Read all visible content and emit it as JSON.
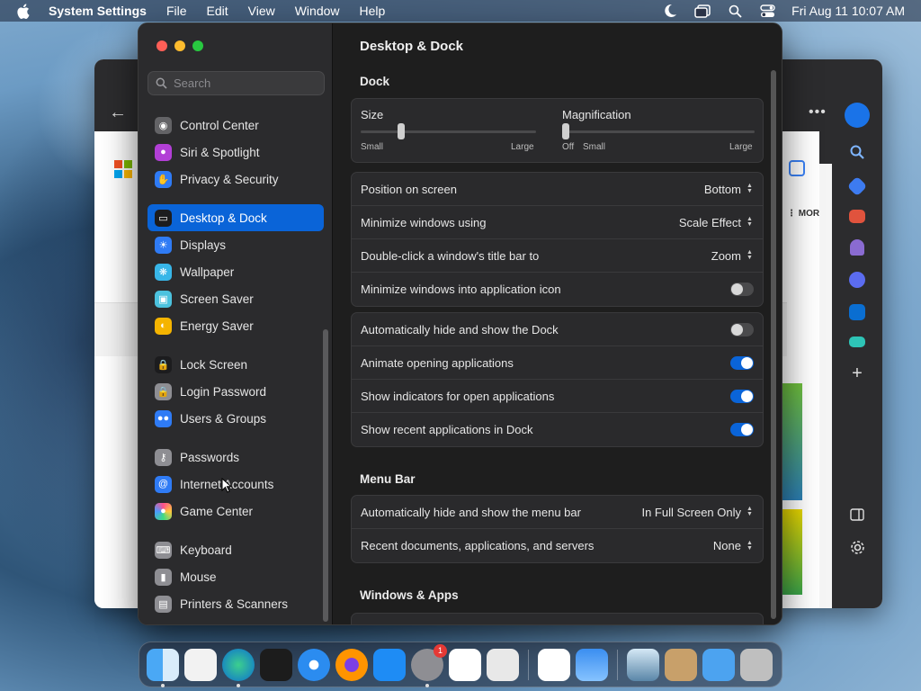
{
  "menubar": {
    "app_name": "System Settings",
    "menus": [
      "File",
      "Edit",
      "View",
      "Window",
      "Help"
    ],
    "clock": "Fri Aug 11  10:07 AM"
  },
  "browser": {
    "more_label": "⋮ MOR"
  },
  "settings": {
    "search_placeholder": "Search",
    "sidebar": [
      {
        "label": "Control Center",
        "icon": "control-center-icon",
        "color": "#636366"
      },
      {
        "label": "Siri & Spotlight",
        "icon": "siri-icon",
        "color": "#b23fd6"
      },
      {
        "label": "Privacy & Security",
        "icon": "hand-icon",
        "color": "#2f7bf5"
      },
      {
        "label": "Desktop & Dock",
        "icon": "dock-icon",
        "color": "#1c1c1e",
        "active": true
      },
      {
        "label": "Displays",
        "icon": "sun-icon",
        "color": "#2f7bf5"
      },
      {
        "label": "Wallpaper",
        "icon": "flower-icon",
        "color": "#38b6e8"
      },
      {
        "label": "Screen Saver",
        "icon": "screen-saver-icon",
        "color": "#4cc2de"
      },
      {
        "label": "Energy Saver",
        "icon": "bulb-icon",
        "color": "#f5b400"
      },
      {
        "label": "Lock Screen",
        "icon": "lock-icon",
        "color": "#1c1c1e"
      },
      {
        "label": "Login Password",
        "icon": "lock-icon",
        "color": "#8e8e93"
      },
      {
        "label": "Users & Groups",
        "icon": "users-icon",
        "color": "#2f7bf5"
      },
      {
        "label": "Passwords",
        "icon": "key-icon",
        "color": "#8e8e93"
      },
      {
        "label": "Internet Accounts",
        "icon": "at-icon",
        "color": "#2f7bf5"
      },
      {
        "label": "Game Center",
        "icon": "game-center-icon",
        "color": "#e8e8e8"
      },
      {
        "label": "Keyboard",
        "icon": "keyboard-icon",
        "color": "#8e8e93"
      },
      {
        "label": "Mouse",
        "icon": "mouse-icon",
        "color": "#8e8e93"
      },
      {
        "label": "Printers & Scanners",
        "icon": "printer-icon",
        "color": "#8e8e93"
      }
    ],
    "title": "Desktop & Dock",
    "dock_section": "Dock",
    "size_label": "Size",
    "size_small": "Small",
    "size_large": "Large",
    "size_level": 0.23,
    "magnification_label": "Magnification",
    "mag_off": "Off",
    "mag_small": "Small",
    "mag_large": "Large",
    "magnification_level": 0,
    "rows_group1": [
      {
        "label": "Position on screen",
        "value": "Bottom"
      },
      {
        "label": "Minimize windows using",
        "value": "Scale Effect"
      },
      {
        "label": "Double-click a window's title bar to",
        "value": "Zoom"
      },
      {
        "label": "Minimize windows into application icon",
        "toggle": false
      }
    ],
    "rows_group2": [
      {
        "label": "Automatically hide and show the Dock",
        "toggle": false
      },
      {
        "label": "Animate opening applications",
        "toggle": true
      },
      {
        "label": "Show indicators for open applications",
        "toggle": true
      },
      {
        "label": "Show recent applications in Dock",
        "toggle": true
      }
    ],
    "menu_bar_section": "Menu Bar",
    "rows_menubar": [
      {
        "label": "Automatically hide and show the menu bar",
        "value": "In Full Screen Only"
      },
      {
        "label": "Recent documents, applications, and servers",
        "value": "None"
      }
    ],
    "windows_section": "Windows & Apps"
  },
  "dock": {
    "apps": [
      "finder-icon",
      "textedit-icon",
      "edge-icon",
      "terminal-icon",
      "safari-icon",
      "firefox-icon",
      "app-store-icon",
      "system-settings-icon",
      "vscode-icon",
      "launchpad-icon"
    ],
    "settings_badge": "1",
    "apps2": [
      "visual-studio-icon",
      "weather-icon"
    ],
    "apps3": [
      "preview-icon",
      "archive-icon",
      "folder-icon",
      "trash-icon"
    ]
  }
}
